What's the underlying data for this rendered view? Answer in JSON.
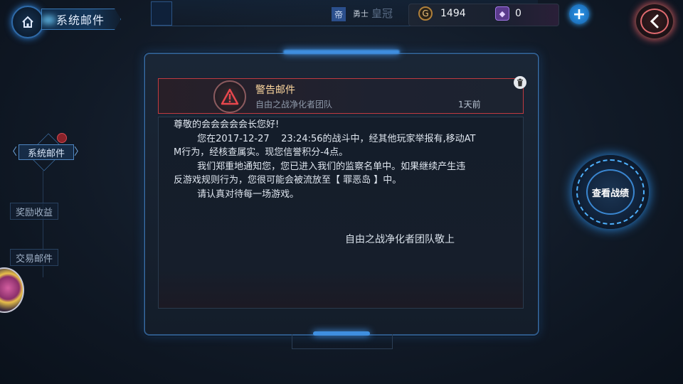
{
  "header": {
    "title": "系统邮件",
    "rank_badge": "帝",
    "rank_title": "勇士",
    "rank_title_faded": "皇冠",
    "gold_icon_glyph": "G",
    "gold_amount": "1494",
    "gem_icon_glyph": "◆",
    "gem_amount": "0",
    "add_symbol": "+"
  },
  "sidebar": {
    "items": [
      {
        "label": "系统邮件",
        "active": true,
        "has_notification": true
      },
      {
        "label": "奖励收益",
        "active": false
      },
      {
        "label": "交易邮件",
        "active": false
      }
    ],
    "chevron_left": "〈",
    "chevron_right": "〉"
  },
  "mail": {
    "title": "警告邮件",
    "sender": "自由之战净化者团队",
    "time_ago": "1天前",
    "body": "尊敬的会会会会会长您好!\n        您在2017-12-27    23:24:56的战斗中，经其他玩家举报有,移动AT\nM行为，经核查属实。现您信誉积分-4点。\n        我们郑重地通知您，您已进入我们的监察名单中。如果继续产生违\n反游戏规则行为，您很可能会被流放至【 罪恶岛 】中。\n        请认真对待每一场游戏。",
    "signature": "自由之战净化者团队敬上"
  },
  "actions": {
    "view_record": "查看战绩"
  },
  "colors": {
    "accent_blue": "#3f8fe0",
    "warning_red": "#c03a40",
    "mail_title": "#ffd9a0"
  },
  "icons": [
    "home-icon",
    "back-arrow-icon",
    "gold-coin-icon",
    "gem-icon",
    "plus-icon",
    "warning-icon",
    "trash-icon"
  ]
}
